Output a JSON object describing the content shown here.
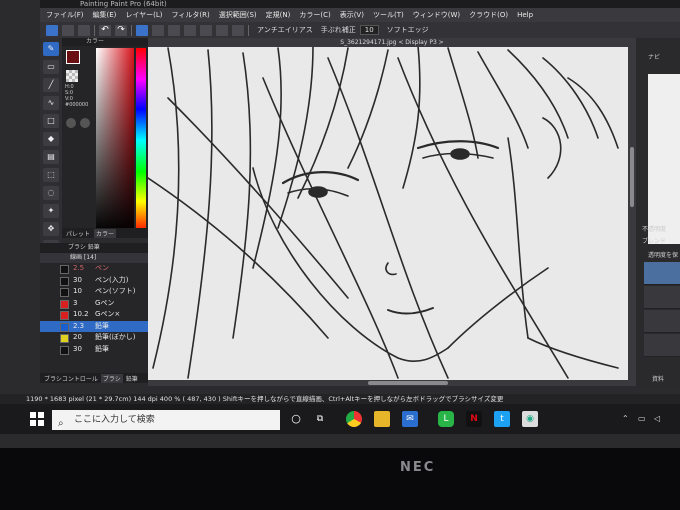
{
  "app": {
    "title": "Painting Paint Pro (64bit)",
    "menu": [
      "ファイル(F)",
      "編集(E)",
      "レイヤー(L)",
      "フィルタ(R)",
      "選択範囲(S)",
      "定規(N)",
      "カラー(C)",
      "表示(V)",
      "ツール(T)",
      "ウィンドウ(W)",
      "クラウド(O)",
      "Help"
    ],
    "toolbar": {
      "antialias_label": "アンチエイリアス",
      "stabilizer_label": "手ぶれ補正",
      "stabilizer_value": "10",
      "soft_edge_label": "ソフトエッジ"
    },
    "document_tab": "S_3621294171.jpg < Display P3 >"
  },
  "color_panel": {
    "title": "カラー",
    "hsv": [
      "H:0",
      "S:0",
      "V:0"
    ],
    "hex": "#000000",
    "foreground_color": "#6a0f12",
    "tabs": [
      "パレット",
      "カラー"
    ]
  },
  "brush_panel": {
    "title": "ブラシ 鉛筆",
    "group": "線画 [14]",
    "items": [
      {
        "size": "2.5",
        "name": "ペン",
        "color": "#111111",
        "selected": false,
        "dim": true
      },
      {
        "size": "30",
        "name": "ペン(入力)",
        "color": "#111111",
        "selected": false
      },
      {
        "size": "10",
        "name": "ペン(ソフト)",
        "color": "#111111",
        "selected": false
      },
      {
        "size": "3",
        "name": "Gペン",
        "color": "#d82020",
        "selected": false
      },
      {
        "size": "10.2",
        "name": "Gペン×",
        "color": "#d82020",
        "selected": false
      },
      {
        "size": "2.3",
        "name": "鉛筆",
        "color": "#1a5fd0",
        "selected": true
      },
      {
        "size": "20",
        "name": "鉛筆(ぼかし)",
        "color": "#e0d020",
        "selected": false
      },
      {
        "size": "30",
        "name": "鉛筆",
        "color": "#111111",
        "selected": false
      }
    ],
    "tabs": [
      "ブラシコントロール",
      "ブラシ",
      "鉛筆"
    ]
  },
  "right_panel": {
    "nav_title": "ナビ",
    "opacity_label": "不透明度",
    "blend_label": "ブレンド",
    "transparency_label": "透明度を保",
    "material_label": "資料"
  },
  "status": {
    "size": "1190 * 1683 pixel",
    "paper": "(21 * 29.7cm)",
    "dpi": "144 dpi",
    "zoom": "400 %",
    "coords": "( 487, 430 )",
    "hint": "Shiftキーを押しながらで直線描画、Ctrl+Altキーを押しながら左ボドラッグでブラシサイズ変更"
  },
  "taskbar": {
    "search_placeholder": "ここに入力して検索"
  },
  "monitor": {
    "brand": "NEC"
  },
  "colors": {
    "accent": "#2f6bc4",
    "canvas": "#e9e9e9"
  }
}
